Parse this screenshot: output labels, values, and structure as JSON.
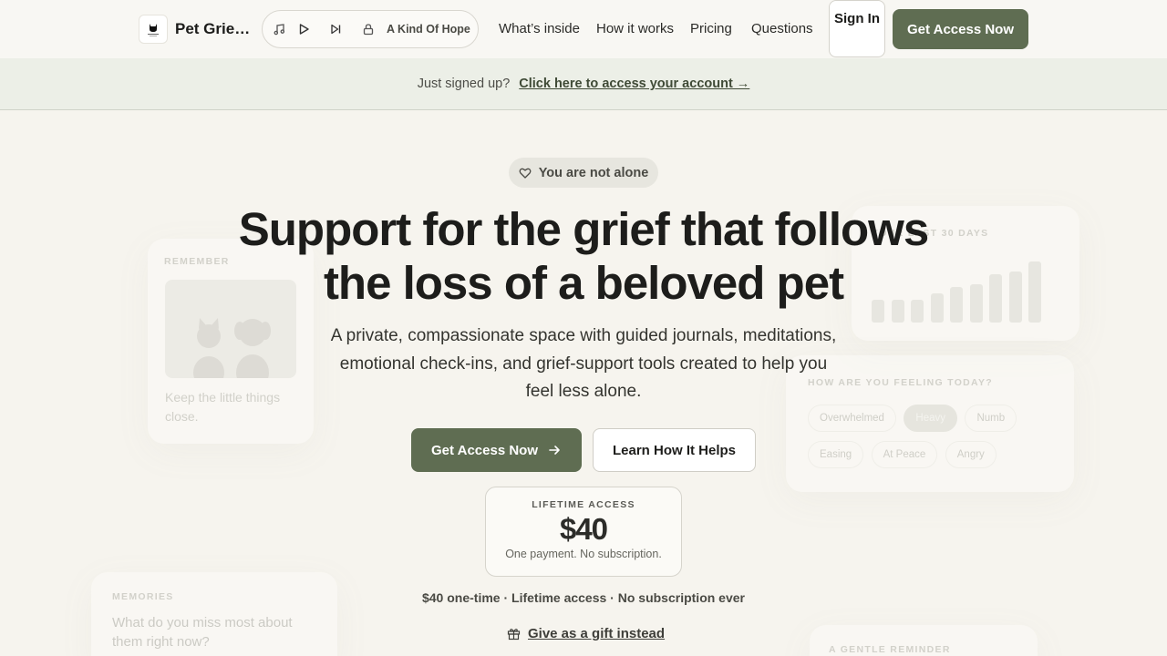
{
  "nav": {
    "brand": "Pet Grief…",
    "player": {
      "track": "A Kind Of Hope"
    },
    "links": [
      "What’s inside",
      "How it works",
      "Pricing",
      "Questions"
    ],
    "signin": "Sign In",
    "cta": "Get Access Now"
  },
  "banner": {
    "text": "Just signed up?",
    "link": "Click here to access your account →"
  },
  "background_cards": {
    "remember": {
      "caption": "REMEMBER",
      "text": "Keep the little things close."
    },
    "last30": {
      "caption": "YOUR LAST 30 DAYS",
      "bars": [
        0.35,
        0.35,
        0.35,
        0.45,
        0.55,
        0.6,
        0.75,
        0.8,
        0.95
      ]
    },
    "feeling": {
      "caption": "HOW ARE YOU FEELING TODAY?",
      "chips_row1": [
        "Overwhelmed",
        "Heavy",
        "Numb"
      ],
      "chips_row2": [
        "Easing",
        "At Peace",
        "Angry"
      ],
      "selected": "Heavy"
    },
    "memories": {
      "caption": "MEMORIES",
      "text": "What do you miss most about them right now?"
    },
    "reminder": {
      "caption": "A GENTLE REMINDER"
    }
  },
  "hero": {
    "pill": "You are not alone",
    "title": "Support for the grief that follows the loss of a beloved pet",
    "subtitle": "A private, compassionate space with guided journals, meditations, emotional check-ins, and grief-support tools created to help you feel less alone.",
    "primary_button": "Get Access Now",
    "secondary_button": "Learn How It Helps",
    "price": {
      "label": "LIFETIME ACCESS",
      "amount": "$40",
      "note": "One payment. No subscription."
    },
    "fineprint": "$40 one-time · Lifetime access · No subscription ever",
    "gift": "Give as a gift instead"
  },
  "colors": {
    "accent": "#5f6d52",
    "background": "#f6f4ee",
    "banner": "#ecefe7"
  }
}
